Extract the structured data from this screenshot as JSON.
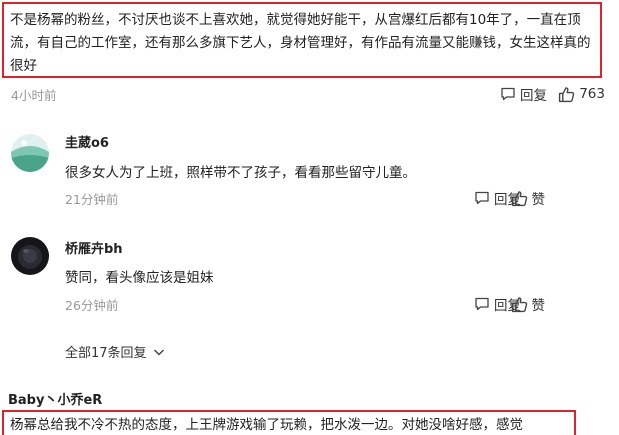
{
  "top_comment": {
    "text": "不是杨幂的粉丝，不讨厌也谈不上喜欢她，就觉得她好能干，从宫爆红后都有10年了，一直在顶流，有自己的工作室，还有那么多旗下艺人，身材管理好，有作品有流量又能赚钱，女生这样真的很好",
    "time": "4小时前",
    "reply_label": "回复",
    "like_count": "763"
  },
  "replies": [
    {
      "name": "圭葳o6",
      "text": "很多女人为了上班，照样带不了孩子，看看那些留守儿童。",
      "time": "21分钟前",
      "reply_label": "回复",
      "like_label": "赞"
    },
    {
      "name": "桥雁卉bh",
      "text": "赞同，看头像应该是姐妹",
      "time": "26分钟前",
      "reply_label": "回复",
      "like_label": "赞"
    }
  ],
  "expand_label": "全部17条回复",
  "next_comment": {
    "name": "Baby丶小乔eR",
    "text": "杨幂总给我不冷不热的态度，上王牌游戏输了玩赖，把水泼一边。对她没啥好感，感觉"
  },
  "colors": {
    "highlight_border": "#e0232a",
    "meta_text": "#999999"
  }
}
